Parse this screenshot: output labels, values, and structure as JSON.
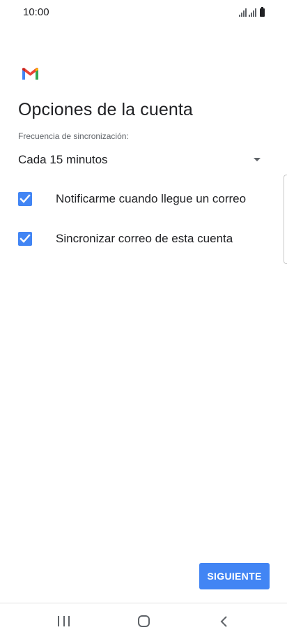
{
  "status_bar": {
    "time": "10:00"
  },
  "logo": {
    "icon": "gmail-logo-icon"
  },
  "page": {
    "title": "Opciones de la cuenta",
    "sync_label": "Frecuencia de sincronización:",
    "sync_value": "Cada 15 minutos"
  },
  "options": [
    {
      "label": "Notificarme cuando llegue un correo",
      "checked": true
    },
    {
      "label": "Sincronizar correo de esta cuenta",
      "checked": true
    }
  ],
  "actions": {
    "next_label": "SIGUIENTE"
  },
  "colors": {
    "accent": "#4285f4",
    "text_primary": "#202124",
    "text_secondary": "#5f6368"
  }
}
